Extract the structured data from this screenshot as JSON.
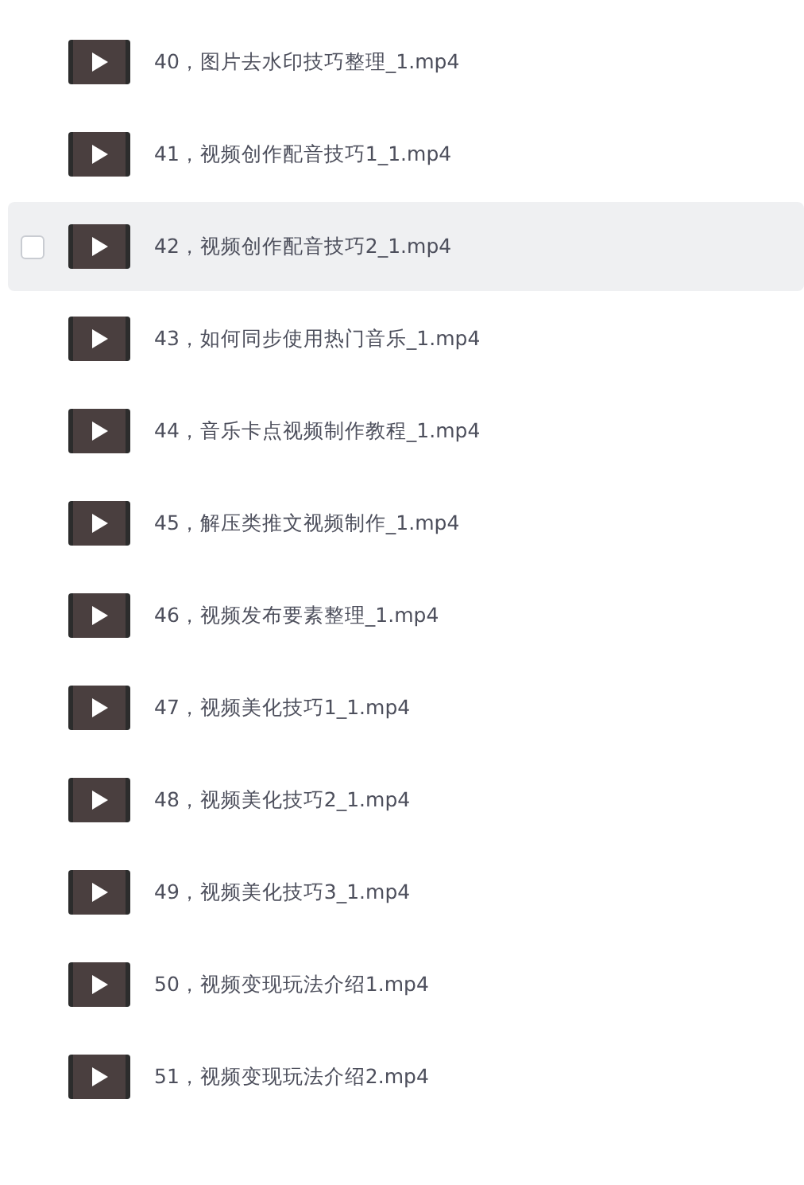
{
  "files": [
    {
      "name": "40，图片去水印技巧整理_1.mp4",
      "hovered": false
    },
    {
      "name": "41，视频创作配音技巧1_1.mp4",
      "hovered": false
    },
    {
      "name": "42，视频创作配音技巧2_1.mp4",
      "hovered": true
    },
    {
      "name": "43，如何同步使用热门音乐_1.mp4",
      "hovered": false
    },
    {
      "name": "44，音乐卡点视频制作教程_1.mp4",
      "hovered": false
    },
    {
      "name": "45，解压类推文视频制作_1.mp4",
      "hovered": false
    },
    {
      "name": "46，视频发布要素整理_1.mp4",
      "hovered": false
    },
    {
      "name": "47，视频美化技巧1_1.mp4",
      "hovered": false
    },
    {
      "name": "48，视频美化技巧2_1.mp4",
      "hovered": false
    },
    {
      "name": "49，视频美化技巧3_1.mp4",
      "hovered": false
    },
    {
      "name": "50，视频变现玩法介绍1.mp4",
      "hovered": false
    },
    {
      "name": "51，视频变现玩法介绍2.mp4",
      "hovered": false
    }
  ]
}
